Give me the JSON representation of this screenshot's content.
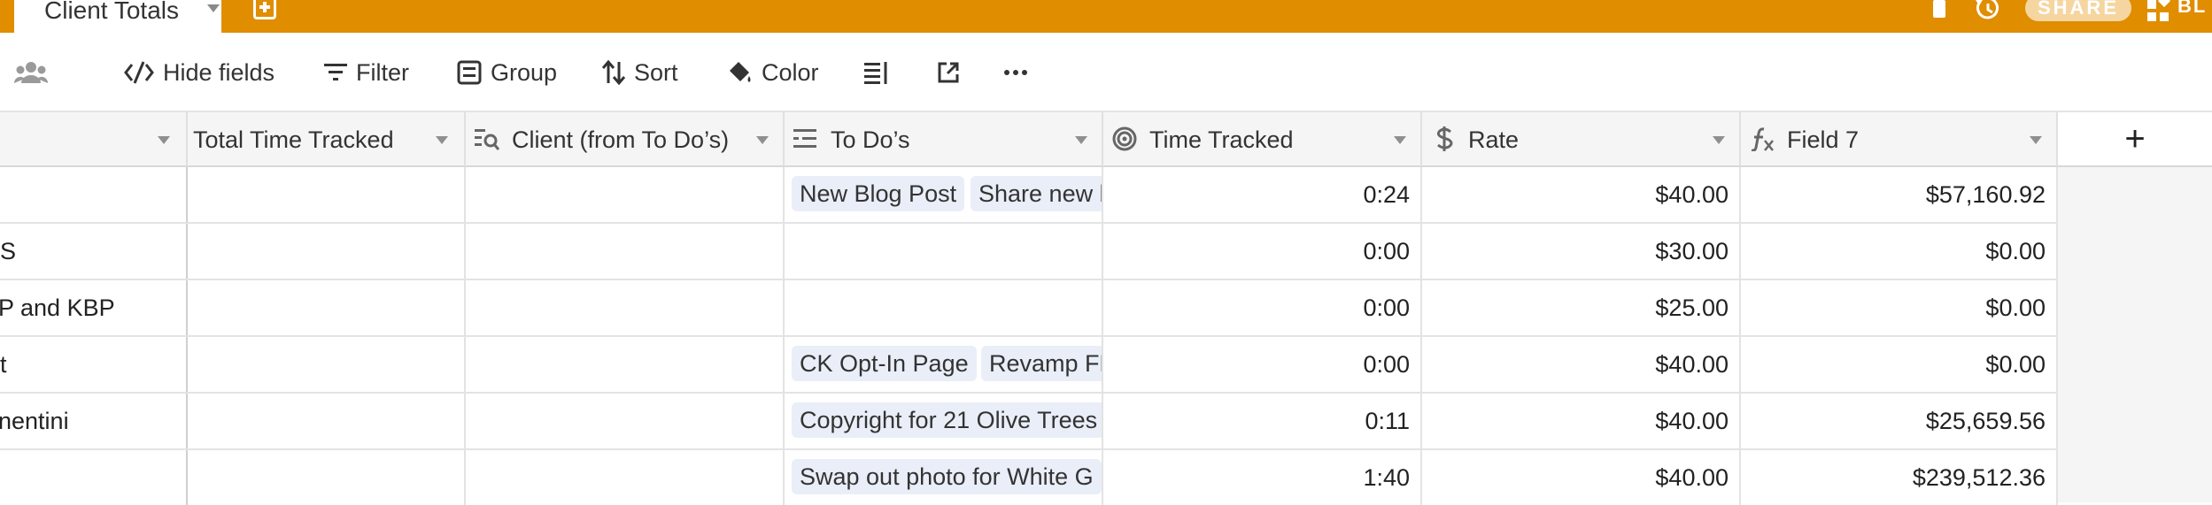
{
  "topbar": {
    "tab_title": "Client Totals",
    "share_label": "SHARE",
    "blocks_label": "BL",
    "accent": "#E08D00"
  },
  "toolbar": {
    "hide_fields": "Hide fields",
    "filter": "Filter",
    "group": "Group",
    "sort": "Sort",
    "color": "Color"
  },
  "columns": [
    {
      "label": "",
      "icon": ""
    },
    {
      "label": "Total Time Tracked",
      "icon": ""
    },
    {
      "label": "Client (from To Do’s)",
      "icon": "lookup-icon"
    },
    {
      "label": "To Do’s",
      "icon": "link-icon"
    },
    {
      "label": "Time Tracked",
      "icon": "duration-icon"
    },
    {
      "label": "Rate",
      "icon": "currency-icon"
    },
    {
      "label": "Field 7",
      "icon": "formula-icon"
    }
  ],
  "rows": [
    {
      "name": "",
      "todos": [
        "New Blog Post",
        "Share new b"
      ],
      "time": "0:24",
      "rate": "$40.00",
      "field7": "$57,160.92"
    },
    {
      "name": "S",
      "todos": [],
      "time": "0:00",
      "rate": "$30.00",
      "field7": "$0.00"
    },
    {
      "name": "P and KBP",
      "todos": [],
      "time": "0:00",
      "rate": "$25.00",
      "field7": "$0.00"
    },
    {
      "name": "t",
      "todos": [
        "CK Opt-In Page",
        "Revamp FB"
      ],
      "time": "0:00",
      "rate": "$40.00",
      "field7": "$0.00"
    },
    {
      "name": "nentini",
      "todos": [
        "Copyright for 21 Olive Trees"
      ],
      "time": "0:11",
      "rate": "$40.00",
      "field7": "$25,659.56"
    },
    {
      "name": "",
      "todos": [
        "Swap out photo for White G"
      ],
      "time": "1:40",
      "rate": "$40.00",
      "field7": "$239,512.36"
    }
  ]
}
